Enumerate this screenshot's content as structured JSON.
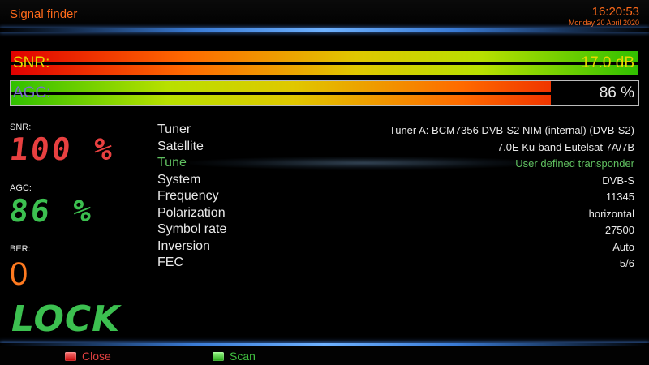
{
  "header": {
    "title": "Signal finder",
    "time": "16:20:53",
    "date": "Monday 20 April 2020"
  },
  "bars": {
    "snr": {
      "label": "SNR:",
      "value": "17.0 dB",
      "level": 1.0
    },
    "agc": {
      "label": "AGC:",
      "value": "86 %",
      "level": 0.86
    }
  },
  "stats": {
    "snr_label": "SNR:",
    "snr_value": "100 %",
    "agc_label": "AGC:",
    "agc_value": "86 %",
    "ber_label": "BER:",
    "ber_value": "0",
    "lock_text": "LOCK"
  },
  "info": [
    {
      "key": "Tuner",
      "value": "Tuner A: BCM7356 DVB-S2 NIM (internal) (DVB-S2)"
    },
    {
      "key": "Satellite",
      "value": "7.0E Ku-band Eutelsat 7A/7B"
    },
    {
      "key": "Tune",
      "value": "User defined transponder"
    },
    {
      "key": "System",
      "value": "DVB-S"
    },
    {
      "key": "Frequency",
      "value": "11345"
    },
    {
      "key": "Polarization",
      "value": "horizontal"
    },
    {
      "key": "Symbol rate",
      "value": "27500"
    },
    {
      "key": "Inversion",
      "value": "Auto"
    },
    {
      "key": "FEC",
      "value": "5/6"
    }
  ],
  "footer": {
    "close_label": "Close",
    "scan_label": "Scan",
    "close_key_icon": "red-key-icon",
    "scan_key_icon": "green-key-icon"
  },
  "colors": {
    "title": "#ff6a1a",
    "highlight": "#60c060",
    "accent_glow": "#6fb2ff"
  }
}
